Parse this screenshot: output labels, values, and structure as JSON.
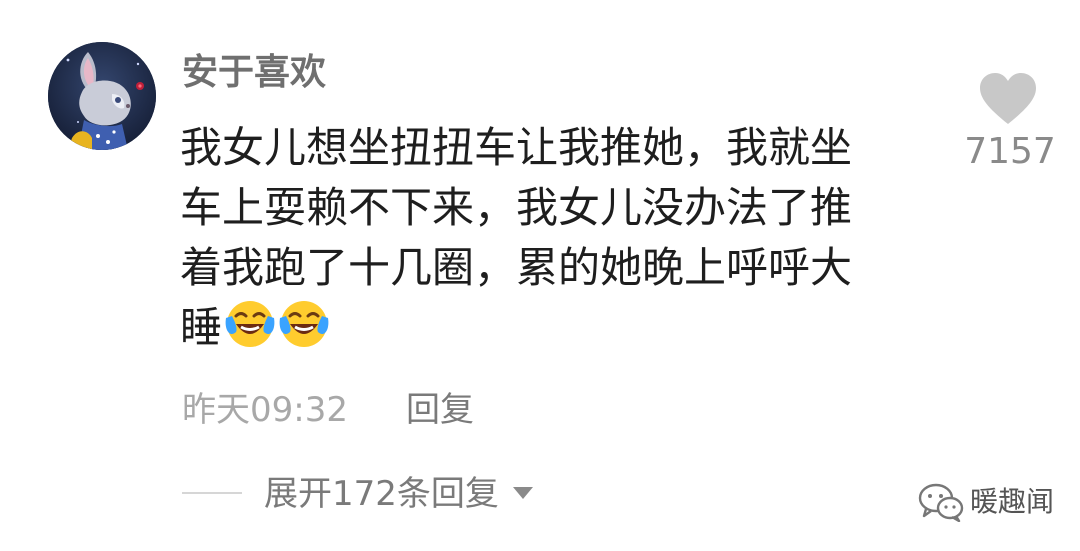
{
  "comment": {
    "username": "安于喜欢",
    "text_lines": [
      "我女儿想坐扭扭车让我推她，我就坐",
      "车上耍赖不下来，我女儿没办法了推",
      "着我跑了十几圈，累的她晚上呼呼大",
      "睡"
    ],
    "trailing_emojis": [
      "laugh-cry-emoji",
      "laugh-cry-emoji"
    ],
    "timestamp": "昨天09:32",
    "reply_label": "回复",
    "like_count": "7157",
    "expand_replies_label": "展开172条回复"
  },
  "watermark": {
    "text": "暖趣闻",
    "icon": "wechat-icon"
  },
  "colors": {
    "background": "#ffffff",
    "text_primary": "#1e1e1e",
    "text_secondary": "#8a8a8a",
    "like_icon": "#c8c8c8"
  }
}
